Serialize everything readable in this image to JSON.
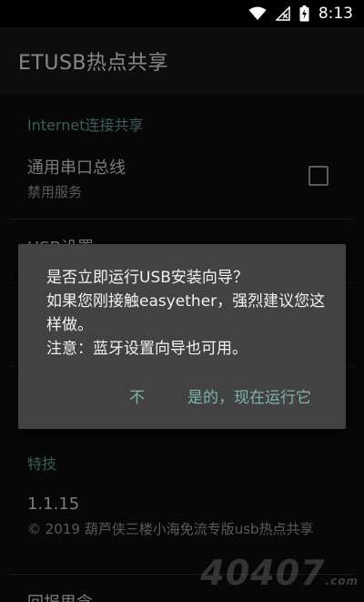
{
  "status_bar": {
    "time": "8:13",
    "icons": [
      "wifi-icon",
      "signal-off-icon",
      "battery-charging-icon"
    ]
  },
  "app_bar": {
    "title": "ETUSB热点共享"
  },
  "settings": {
    "internet_section": "Internet连接共享",
    "serial_bus": {
      "title": "通用串口总线",
      "summary": "禁用服务",
      "checked": false
    },
    "usb_settings_partial": "USB设置",
    "special_section": "特技",
    "version": {
      "title": "1.1.15",
      "summary": "© 2019 葫芦侠三楼小海免流专版usb热点共享"
    },
    "bottom_partial": "回报思念"
  },
  "dialog": {
    "message": "是否立即运行USB安装向导？\n如果您刚接触easyether，强烈建议您这样做。\n注意：蓝牙设置向导也可用。",
    "negative_button": "不",
    "positive_button": "是的，现在运行它"
  },
  "watermark": {
    "text": "40407",
    "suffix": ".com"
  },
  "colors": {
    "accent": "#5f8d88",
    "dialog_button": "#7fb3ac",
    "dialog_background": "#424242",
    "app_bar": "#141414"
  }
}
